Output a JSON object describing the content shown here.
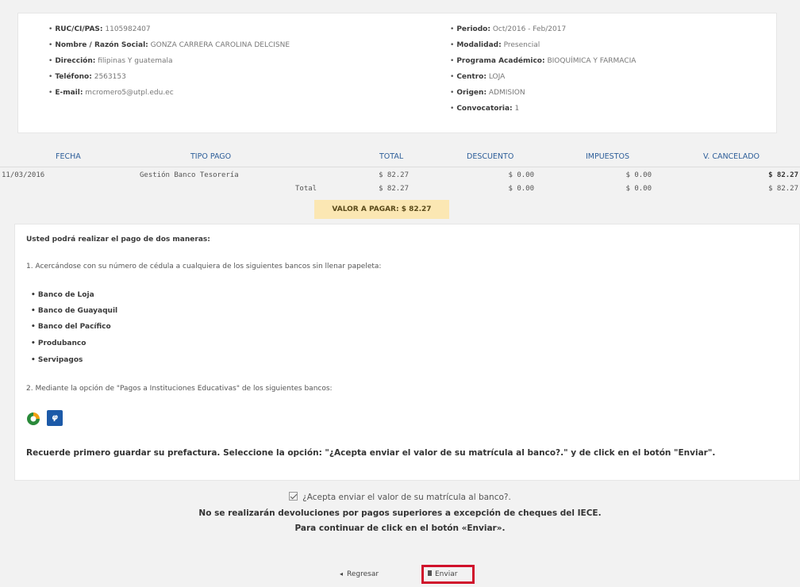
{
  "student": {
    "left": [
      {
        "label": "RUC/CI/PAS:",
        "value": "1105982407"
      },
      {
        "label": "Nombre / Razón Social:",
        "value": "GONZA CARRERA CAROLINA DELCISNE"
      },
      {
        "label": "Dirección:",
        "value": "filipinas Y guatemala"
      },
      {
        "label": "Teléfono:",
        "value": "2563153"
      },
      {
        "label": "E-mail:",
        "value": "mcromero5@utpl.edu.ec"
      }
    ],
    "right": [
      {
        "label": "Periodo:",
        "value": "Oct/2016 - Feb/2017"
      },
      {
        "label": "Modalidad:",
        "value": "Presencial"
      },
      {
        "label": "Programa Académico:",
        "value": "BIOQUÍMICA Y FARMACIA"
      },
      {
        "label": "Centro:",
        "value": "LOJA"
      },
      {
        "label": "Origen:",
        "value": "ADMISION"
      },
      {
        "label": "Convocatoria:",
        "value": "1"
      }
    ]
  },
  "table": {
    "headers": [
      "FECHA",
      "TIPO PAGO",
      "TOTAL",
      "DESCUENTO",
      "IMPUESTOS",
      "V. CANCELADO"
    ],
    "row": {
      "fecha": "11/03/2016",
      "tipo": "Gestión Banco Tesorería",
      "total": "$ 82.27",
      "descuento": "$ 0.00",
      "impuestos": "$ 0.00",
      "cancelado": "$ 82.27"
    },
    "totals": {
      "label": "Total",
      "total": "$ 82.27",
      "descuento": "$ 0.00",
      "impuestos": "$ 0.00",
      "cancelado": "$ 82.27"
    },
    "valor_a_pagar": "VALOR A PAGAR: $ 82.27"
  },
  "instructions": {
    "intro": "Usted podrá realizar el pago de dos maneras:",
    "option1": "1. Acercándose con su número de cédula a cualquiera de los siguientes bancos sin llenar papeleta:",
    "banks": [
      "Banco de Loja",
      "Banco de Guayaquil",
      "Banco del Pacífico",
      "Produbanco",
      "Servipagos"
    ],
    "option2": "2. Mediante la opción de \"Pagos a Instituciones Educativas\" de los siguientes bancos:",
    "logo2_glyph": "φ",
    "reminder": "Recuerde primero guardar su prefactura. Seleccione la opción: \"¿Acepta enviar el valor de su matrícula al banco?.\" y de click en el botón \"Enviar\"."
  },
  "accept": {
    "checkbox_label": "¿Acepta enviar el valor de su matrícula al banco?.",
    "checked": true,
    "warning": "No se realizarán devoluciones por pagos superiores a excepción de cheques del IECE.",
    "continue": "Para continuar de click en el botón «Enviar»."
  },
  "buttons": {
    "back": "Regresar",
    "send": "Enviar"
  },
  "colors": {
    "header_text": "#2d5e99",
    "valor_bg": "#fbe7b3",
    "highlight_border": "#d0112b",
    "page_bg": "#f2f2f2"
  }
}
